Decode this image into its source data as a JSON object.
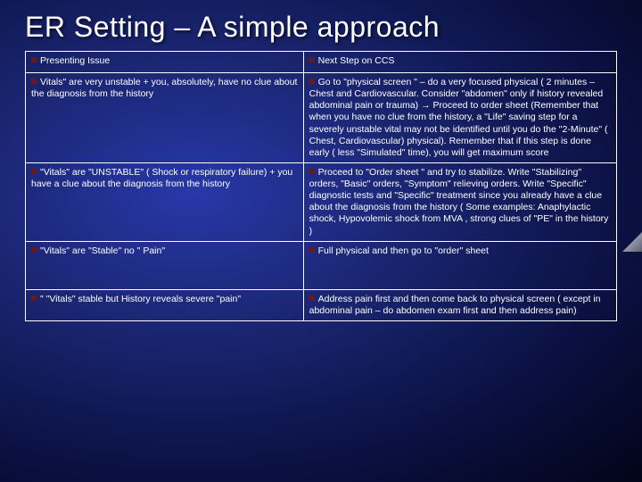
{
  "title": "ER Setting – A simple approach",
  "headers": {
    "left": "Presenting Issue",
    "right": "Next Step on CCS"
  },
  "rows": [
    {
      "issue": "Vitals\" are very unstable + you, absolutely, have no clue about the diagnosis from the history",
      "step": "Go to \"physical screen \" – do a very focused physical ( 2 minutes – Chest and Cardiovascular. Consider \"abdomen\" only if history revealed abdominal pain or trauma) → Proceed to order sheet (Remember that when you have no clue from the history, a  \"Life\" saving step for a severely unstable vital may not be identified until you do the \"2-Minute\" ( Chest, Cardiovascular) physical). Remember that if this step is done early ( less \"Simulated\" time),  you will get maximum score"
    },
    {
      "issue": "\"Vitals\" are \"UNSTABLE\" ( Shock or respiratory failure) + you have a clue about the diagnosis from the history",
      "step": "Proceed to \"Order sheet \"  and try to stabilize. Write \"Stabilizing\" orders, \"Basic\" orders, \"Symptom\" relieving orders. Write \"Specific\" diagnostic tests and \"Specific\" treatment since you already have a clue about the diagnosis from the history ( Some examples: Anaphylactic shock, Hypovolemic shock from MVA , strong clues of \"PE\" in the history )"
    },
    {
      "issue": "\"Vitals\" are \"Stable\"  no \" Pain\"",
      "step": "Full physical and then go to \"order\" sheet"
    },
    {
      "issue": "\" \"Vitals\" stable but History reveals severe \"pain\"",
      "step": "Address pain first and then come back to physical screen ( except in abdominal pain – do abdomen exam first and then address pain)"
    }
  ]
}
